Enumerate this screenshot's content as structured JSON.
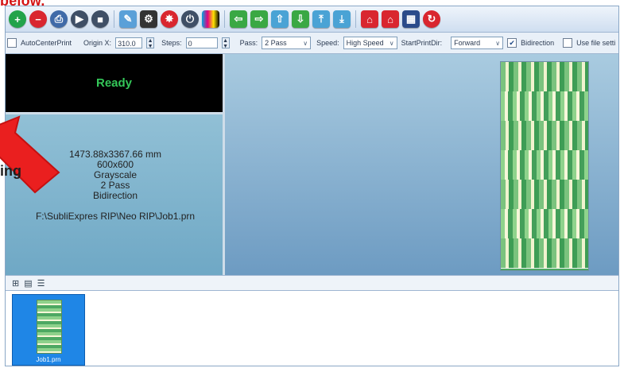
{
  "page": {
    "top_text": "below."
  },
  "toolbar": {
    "icons": [
      "add-icon",
      "remove-icon",
      "print-icon",
      "play-icon",
      "stop-icon",
      "edit-icon",
      "settings-icon",
      "clean-icon",
      "power-icon",
      "color-icon",
      "arrow-left-icon",
      "arrow-right-icon",
      "move-up-icon",
      "move-down-icon",
      "upload-icon",
      "download-icon",
      "home-icon",
      "home-alt-icon",
      "display-icon",
      "refresh-icon"
    ]
  },
  "settings": {
    "autocenter_label": "AutoCenterPrint",
    "origin_label": "Origin X:",
    "origin_value": "310.0",
    "steps_label": "Steps:",
    "steps_value": "0",
    "pass_label": "Pass:",
    "pass_value": "2 Pass",
    "speed_label": "Speed:",
    "speed_value": "High Speed",
    "start_dir_label": "StartPrintDir:",
    "start_dir_value": "Forward",
    "bidirection_label": "Bidirection",
    "use_file_label": "Use file setti"
  },
  "left": {
    "status": "Ready",
    "size": "1473.88x3367.66 mm",
    "dpi": "600x600",
    "color_mode": "Grayscale",
    "pass": "2 Pass",
    "direction": "Bidirection",
    "path": "F:\\SubliExpres RIP\\Neo RIP\\Job1.prn"
  },
  "arrow": {
    "label": "ing"
  },
  "job": {
    "name": "Job1.prn"
  }
}
